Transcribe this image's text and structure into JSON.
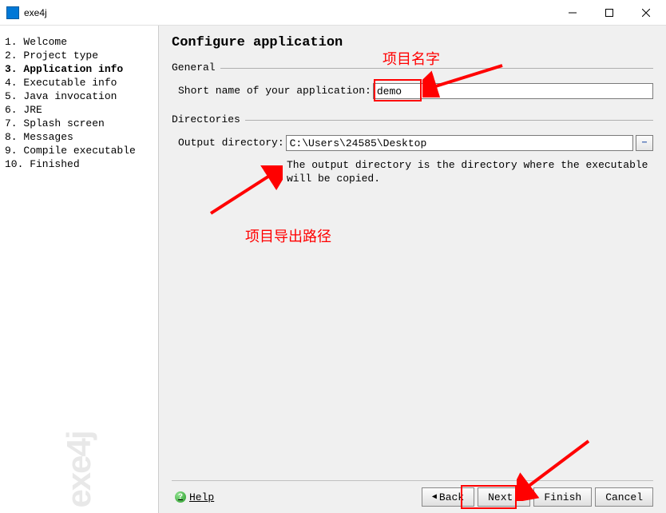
{
  "window": {
    "title": "exe4j"
  },
  "sidebar": {
    "items": [
      {
        "num": "1.",
        "label": "Welcome",
        "active": false
      },
      {
        "num": "2.",
        "label": "Project type",
        "active": false
      },
      {
        "num": "3.",
        "label": "Application info",
        "active": true
      },
      {
        "num": "4.",
        "label": "Executable info",
        "active": false
      },
      {
        "num": "5.",
        "label": "Java invocation",
        "active": false
      },
      {
        "num": "6.",
        "label": "JRE",
        "active": false
      },
      {
        "num": "7.",
        "label": "Splash screen",
        "active": false
      },
      {
        "num": "8.",
        "label": "Messages",
        "active": false
      },
      {
        "num": "9.",
        "label": "Compile executable",
        "active": false
      },
      {
        "num": "10.",
        "label": "Finished",
        "active": false
      }
    ],
    "watermark": "exe4j"
  },
  "main": {
    "title": "Configure application",
    "sections": {
      "general": {
        "legend": "General",
        "short_name_label": "Short name of your application:",
        "short_name_value": "demo"
      },
      "directories": {
        "legend": "Directories",
        "output_label": "Output directory:",
        "output_value": "C:\\Users\\24585\\Desktop",
        "output_desc": "The output directory is the directory where the executable will be copied."
      }
    }
  },
  "footer": {
    "help": "Help",
    "back": "Back",
    "next": "Next",
    "finish": "Finish",
    "cancel": "Cancel"
  },
  "annotations": {
    "name_label": "项目名字",
    "export_label": "项目导出路径"
  }
}
